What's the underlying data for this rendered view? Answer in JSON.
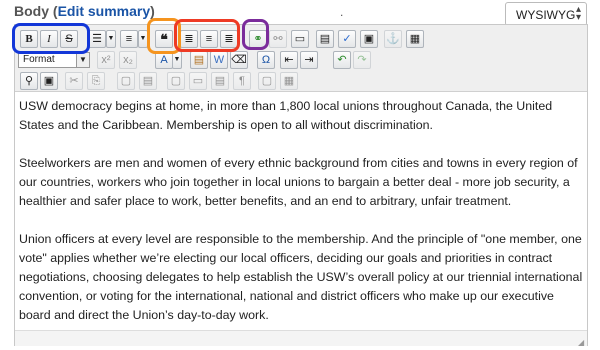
{
  "field": {
    "label": "Body",
    "open_paren": "(",
    "edit_link": "Edit summary",
    "close_paren": ")",
    "dot": "."
  },
  "format_switcher": {
    "value": "WYSIWYG",
    "options_visible": [
      "WYSIWYG"
    ]
  },
  "toolbar": {
    "bold": "B",
    "italic": "I",
    "strike": "S",
    "blockquote": "❝",
    "format_select": "Format"
  },
  "highlights": {
    "blue": "#1337d8",
    "orange": "#f5941e",
    "red": "#ee3a24",
    "purple": "#7b2c9b"
  },
  "content": {
    "paragraphs": [
      "USW democracy begins at home, in more than 1,800 local unions throughout Canada, the United States and the Caribbean. Membership is open to all without discrimination.",
      "Steelworkers are men and women of every ethnic background from cities and towns in every region of our countries, workers who join together in local unions to bargain a better deal - more job security, a healthier and safer place to work, better benefits, and an end to arbitrary, unfair treatment.",
      "Union officers at every level are responsible to the membership. And the principle of \"one member, one vote\" applies whether we’re electing our local officers, deciding our goals and priorities in contract negotiations, choosing delegates to help establish the USW’s overall policy at our triennial international convention, or voting for the international, national and district officers who make up our executive board and direct the Union’s day-to-day work."
    ]
  }
}
